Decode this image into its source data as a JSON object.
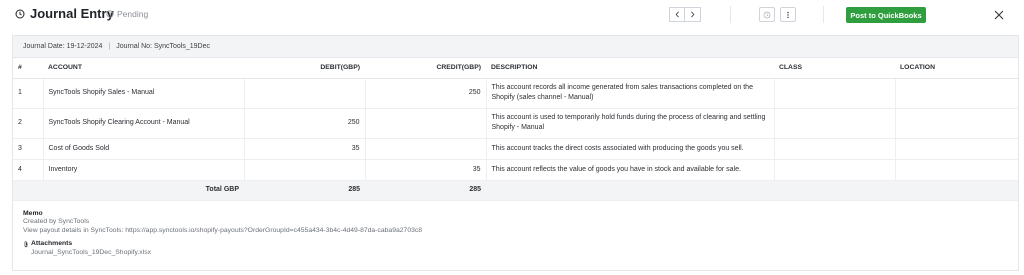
{
  "header": {
    "title": "Journal Entry",
    "status": "Pending",
    "post_button": "Post to QuickBooks"
  },
  "meta": {
    "journal_date": "Journal Date: 19-12-2024",
    "separator": "|",
    "journal_no": "Journal No: SyncTools_19Dec"
  },
  "table": {
    "columns": [
      "#",
      "ACCOUNT",
      "DEBIT(GBP)",
      "CREDIT(GBP)",
      "DESCRIPTION",
      "CLASS",
      "LOCATION"
    ],
    "rows": [
      {
        "num": "1",
        "account": "SyncTools Shopify Sales - Manual",
        "debit": "",
        "credit": "250",
        "description": "This account records all income generated from sales transactions completed on the Shopify (sales channel - Manual)",
        "class": "",
        "location": ""
      },
      {
        "num": "2",
        "account": "SyncTools Shopify Clearing Account - Manual",
        "debit": "250",
        "credit": "",
        "description": "This account is used to temporarily hold funds during the process of clearing and settling Shopify - Manual",
        "class": "",
        "location": ""
      },
      {
        "num": "3",
        "account": "Cost of Goods Sold",
        "debit": "35",
        "credit": "",
        "description": "This account tracks the direct costs associated with producing the goods you sell.",
        "class": "",
        "location": ""
      },
      {
        "num": "4",
        "account": "Inventory",
        "debit": "",
        "credit": "35",
        "description": "This account reflects the value of goods you have in stock and available for sale.",
        "class": "",
        "location": ""
      }
    ],
    "total_label": "Total GBP",
    "total_debit": "285",
    "total_credit": "285"
  },
  "memo": {
    "title": "Memo",
    "line1": "Created by SyncTools",
    "line2": "View payout details in SyncTools: https://app.synctools.io/shopify-payouts?OrderGroupId=c455a434-3b4c-4d49-87da-caba9a2703c8",
    "attachments_title": "Attachments",
    "attachment_file": "Journal_SyncTools_19Dec_Shopify.xlsx"
  },
  "colors": {
    "post_button": "#2e9e3e",
    "meta_background": "#f3f4f6"
  },
  "icons": [
    "journal-icon",
    "pending-clock-icon",
    "chevron-left-icon",
    "chevron-right-icon",
    "history-icon",
    "more-vertical-icon",
    "close-icon",
    "paperclip-icon"
  ]
}
